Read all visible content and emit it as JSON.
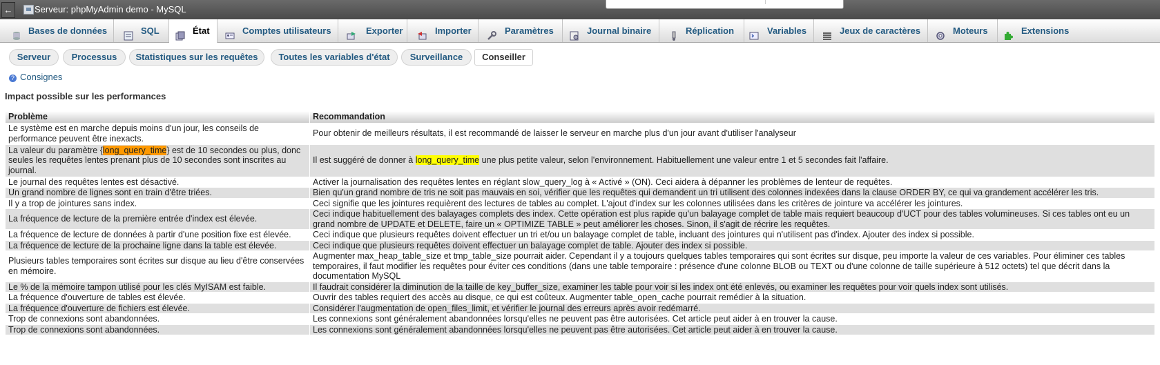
{
  "window": {
    "title": "Serveur: phpMyAdmin demo - MySQL",
    "back_glyph": "←"
  },
  "tabs": [
    {
      "label": "Bases de données",
      "icon": "database-icon"
    },
    {
      "label": "SQL",
      "icon": "sql-icon"
    },
    {
      "label": "État",
      "icon": "status-icon"
    },
    {
      "label": "Comptes utilisateurs",
      "icon": "users-icon"
    },
    {
      "label": "Exporter",
      "icon": "export-icon"
    },
    {
      "label": "Importer",
      "icon": "import-icon"
    },
    {
      "label": "Paramètres",
      "icon": "wrench-icon"
    },
    {
      "label": "Journal binaire",
      "icon": "binlog-icon"
    },
    {
      "label": "Réplication",
      "icon": "replication-icon"
    },
    {
      "label": "Variables",
      "icon": "variables-icon"
    },
    {
      "label": "Jeux de caractères",
      "icon": "charset-icon"
    },
    {
      "label": "Moteurs",
      "icon": "engines-icon"
    },
    {
      "label": "Extensions",
      "icon": "puzzle-icon"
    }
  ],
  "active_tab": "État",
  "subtabs": [
    "Serveur",
    "Processus",
    "Statistiques sur les requêtes",
    "Toutes les variables d'état",
    "Surveillance",
    "Conseiller"
  ],
  "active_subtab": "Conseiller",
  "help_link": "Consignes",
  "section_title": "Impact possible sur les performances",
  "table": {
    "headers": {
      "problem": "Problème",
      "recommendation": "Recommandation"
    },
    "rows": [
      {
        "problem": "Le système est en marche depuis moins d'un jour, les conseils de performance peuvent être inexacts.",
        "recommendation": "Pour obtenir de meilleurs résultats, il est recommandé de laisser le serveur en marche plus d'un jour avant d'utiliser l'analyseur"
      },
      {
        "problem_pre": "La valeur du paramètre {",
        "problem_hl": "long_query_time",
        "problem_post": "} est de 10 secondes ou plus, donc seules les requêtes lentes prenant plus de 10 secondes sont inscrites au journal.",
        "rec_pre": "Il est suggéré de donner à ",
        "rec_hl": "long_query_time",
        "rec_post": " une plus petite valeur, selon l'environnement. Habituellement une valeur entre 1 et 5 secondes fait l'affaire."
      },
      {
        "problem": "Le journal des requêtes lentes est désactivé.",
        "recommendation": "Activer la journalisation des requêtes lentes en réglant slow_query_log à « Activé » (ON). Ceci aidera à dépanner les problèmes de lenteur de requêtes."
      },
      {
        "problem": "Un grand nombre de lignes sont en train d'être triées.",
        "recommendation": "Bien qu'un grand nombre de tris ne soit pas mauvais en soi, vérifier que les requêtes qui demandent un tri utilisent des colonnes indexées dans la clause ORDER BY, ce qui va grandement accélérer les tris."
      },
      {
        "problem": "Il y a trop de jointures sans index.",
        "recommendation": "Ceci signifie que les jointures requièrent des lectures de tables au complet. L'ajout d'index sur les colonnes utilisées dans les critères de jointure va accélérer les jointures."
      },
      {
        "problem": "La fréquence de lecture de la première entrée d'index est élevée.",
        "recommendation": "Ceci indique habituellement des balayages complets des index. Cette opération est plus rapide qu'un balayage complet de table mais requiert beaucoup d'UCT pour des tables volumineuses. Si ces tables ont eu un grand nombre de UPDATE et DELETE, faire un « OPTIMIZE TABLE » peut améliorer les choses. Sinon, il s'agit de récrire les requêtes."
      },
      {
        "problem": "La fréquence de lecture de données à partir d'une position fixe est élevée.",
        "recommendation": "Ceci indique que plusieurs requêtes doivent effectuer un tri et/ou un balayage complet de table, incluant des jointures qui n'utilisent pas d'index. Ajouter des index si possible."
      },
      {
        "problem": "La fréquence de lecture de la prochaine ligne dans la table est élevée.",
        "recommendation": "Ceci indique que plusieurs requêtes doivent effectuer un balayage complet de table. Ajouter des index si possible."
      },
      {
        "problem": "Plusieurs tables temporaires sont écrites sur disque au lieu d'être conservées en mémoire.",
        "recommendation": "Augmenter max_heap_table_size et tmp_table_size pourrait aider. Cependant il y a toujours quelques tables temporaires qui sont écrites sur disque, peu importe la valeur de ces variables. Pour éliminer ces tables temporaires, il faut modifier les requêtes pour éviter ces conditions (dans une table temporaire : présence d'une colonne BLOB ou TEXT ou d'une colonne de taille supérieure à 512 octets) tel que décrit dans la documentation MySQL"
      },
      {
        "problem": "Le % de la mémoire tampon utilisé pour les clés MyISAM est faible.",
        "recommendation": "Il faudrait considérer la diminution de la taille de key_buffer_size, examiner les table pour voir si les index ont été enlevés, ou examiner les requêtes pour voir quels index sont utilisés."
      },
      {
        "problem": "La fréquence d'ouverture de tables est élevée.",
        "recommendation": "Ouvrir des tables requiert des accès au disque, ce qui est coûteux. Augmenter table_open_cache pourrait remédier à la situation."
      },
      {
        "problem": "La fréquence d'ouverture de fichiers est élevée.",
        "recommendation": "Considérer l'augmentation de open_files_limit, et vérifier le journal des erreurs après avoir redémarré."
      },
      {
        "problem": "Trop de connexions sont abandonnées.",
        "recommendation": "Les connexions sont généralement abandonnées lorsqu'elles ne peuvent pas être autorisées. Cet article peut aider à en trouver la cause."
      },
      {
        "problem": "Trop de connexions sont abandonnées.",
        "recommendation": "Les connexions sont généralement abandonnées lorsqu'elles ne peuvent pas être autorisées. Cet article peut aider à en trouver la cause."
      }
    ]
  },
  "colors": {
    "link": "#235a81",
    "highlight_orange": "#ff9900",
    "highlight_yellow": "#ffff00",
    "row_alt": "#dfdfdf"
  }
}
